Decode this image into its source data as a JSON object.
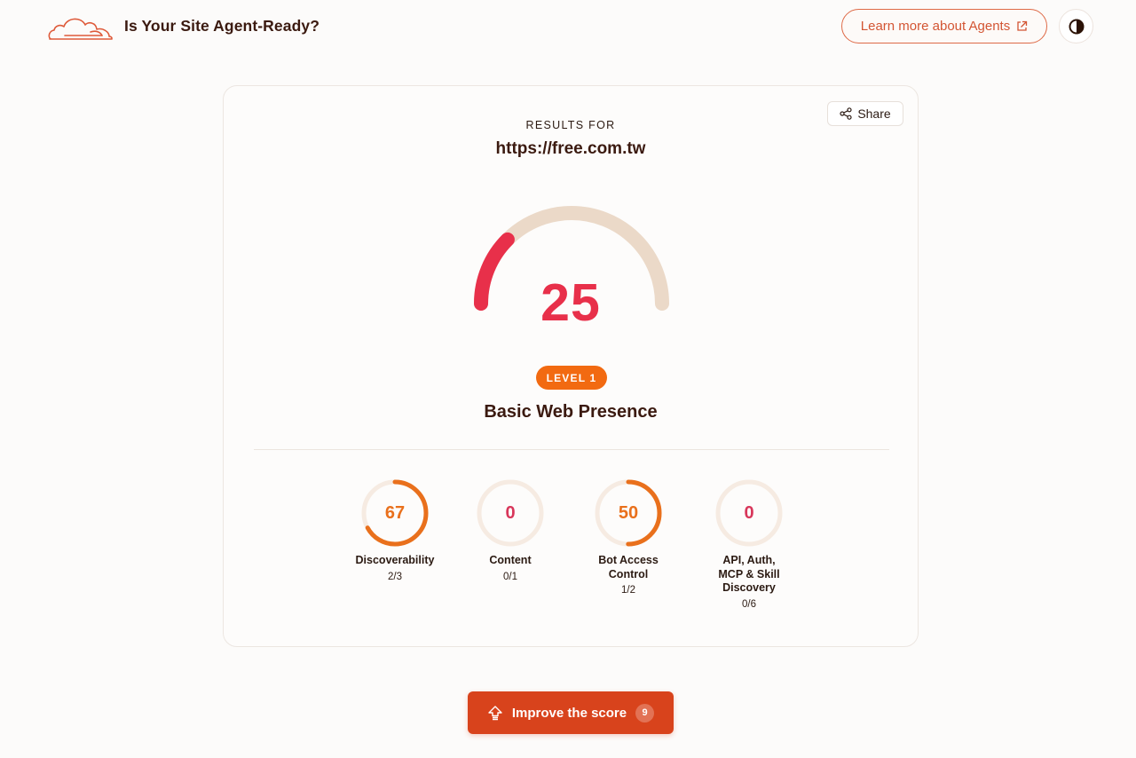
{
  "header": {
    "title": "Is Your Site Agent-Ready?",
    "learn_more_label": "Learn more about Agents",
    "learn_more_icon": "external-link-icon",
    "theme_icon": "contrast-icon"
  },
  "results": {
    "share_label": "Share",
    "results_for_label": "RESULTS FOR",
    "url": "https://free.com.tw",
    "score": "25",
    "score_value": 25,
    "level_label": "LEVEL 1",
    "level_title": "Basic Web Presence"
  },
  "categories": [
    {
      "name": "Discoverability",
      "score": "67",
      "score_value": 67,
      "fraction": "2/3",
      "color": "#e9701c"
    },
    {
      "name": "Content",
      "score": "0",
      "score_value": 0,
      "fraction": "0/1",
      "color": "#d8365a"
    },
    {
      "name": "Bot Access Control",
      "score": "50",
      "score_value": 50,
      "fraction": "1/2",
      "color": "#e9701c"
    },
    {
      "name": "API, Auth, MCP & Skill Discovery",
      "score": "0",
      "score_value": 0,
      "fraction": "0/6",
      "color": "#d8365a"
    }
  ],
  "improve": {
    "label": "Improve the score",
    "count": "9"
  },
  "colors": {
    "accent": "#d8431c",
    "gauge_fill": "#e8304a",
    "gauge_track": "#ebd9c8",
    "level_badge": "#f26a11"
  }
}
